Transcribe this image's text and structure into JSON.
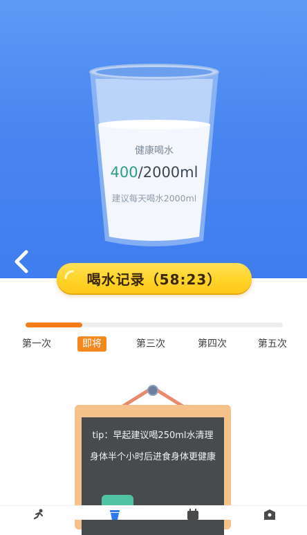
{
  "hero": {
    "bg_color": "#4a86f0",
    "back_icon": "chevron-left-icon",
    "glass": {
      "label": "健康喝水",
      "current_ml": "400",
      "goal_ml": "/2000ml",
      "suggestion": "建议每天喝水2000ml",
      "progress": 0.2
    }
  },
  "record": {
    "label": "喝水记录（58:23）",
    "icon": "spinner-icon",
    "accent_color": "#ffd52c"
  },
  "schedule": {
    "progress": 0.22,
    "progress_color": "#f57c17",
    "steps": [
      {
        "label": "第一次",
        "active": false
      },
      {
        "label": "即将",
        "active": true
      },
      {
        "label": "第三次",
        "active": false
      },
      {
        "label": "第四次",
        "active": false
      },
      {
        "label": "第五次",
        "active": false
      }
    ]
  },
  "tip_board": {
    "text": "tip：早起建议喝250ml水清理身体半个小时后进食身体更健康",
    "board_color": "#474b4e"
  },
  "bottom_nav": {
    "items": [
      {
        "icon": "running-icon"
      },
      {
        "icon": "water-cup-icon"
      },
      {
        "icon": "calendar-icon"
      },
      {
        "icon": "profile-icon"
      }
    ]
  }
}
